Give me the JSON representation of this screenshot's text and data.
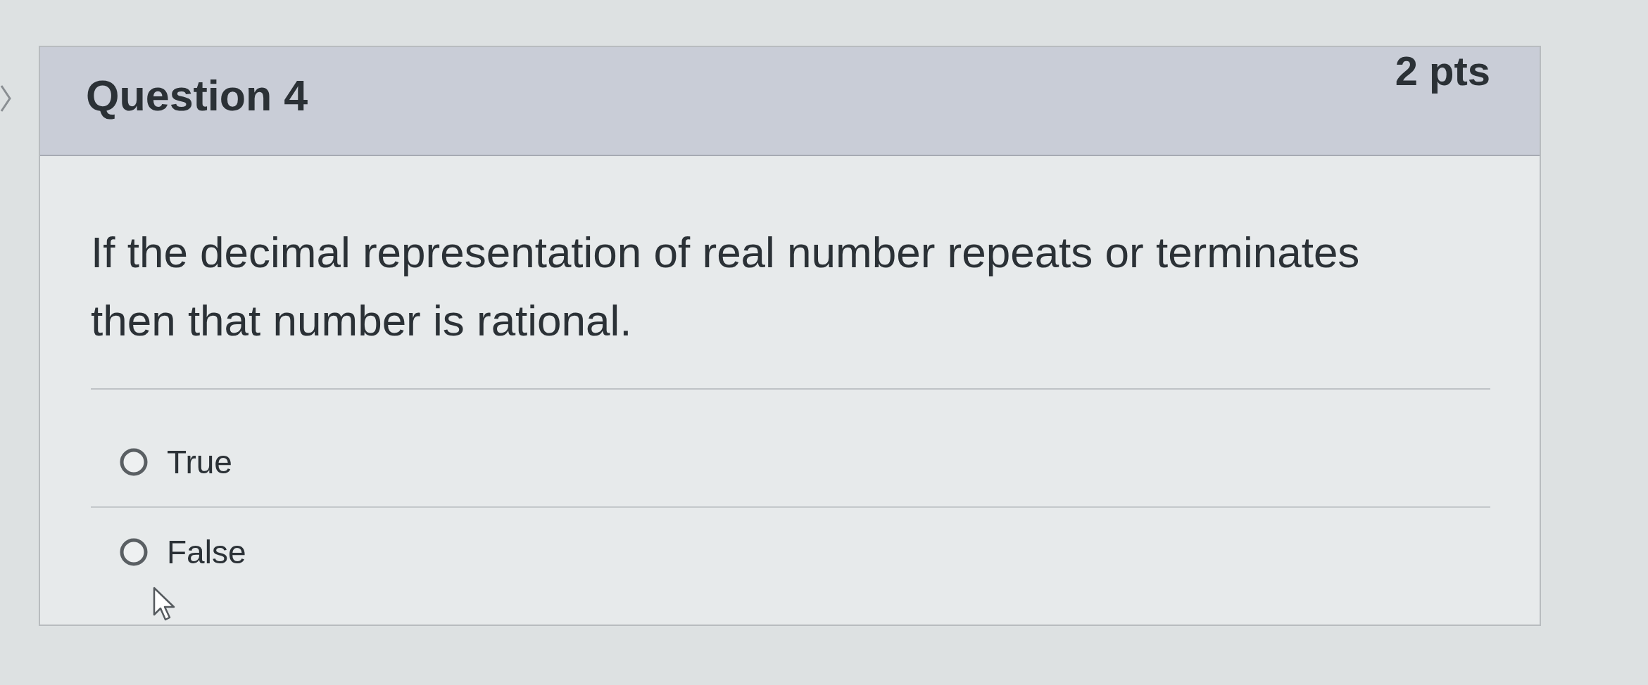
{
  "question": {
    "title": "Question 4",
    "points": "2 pts",
    "text": "If the decimal representation of real number repeats or terminates then that number is rational.",
    "answers": [
      {
        "label": "True",
        "selected": false
      },
      {
        "label": "False",
        "selected": false
      }
    ]
  }
}
